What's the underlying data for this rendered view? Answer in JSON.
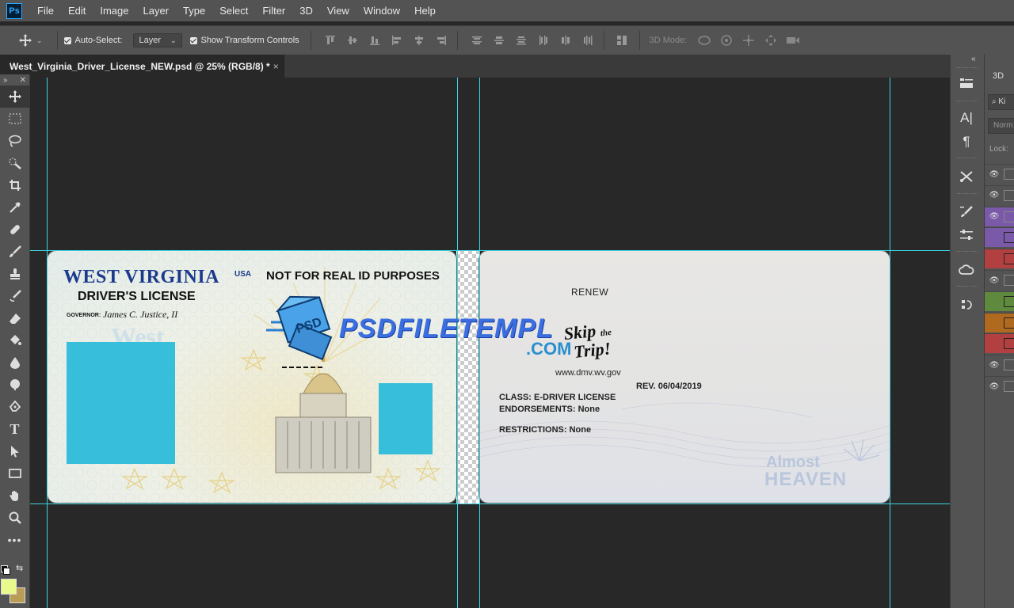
{
  "app": {
    "logo": "Ps"
  },
  "menu": [
    "File",
    "Edit",
    "Image",
    "Layer",
    "Type",
    "Select",
    "Filter",
    "3D",
    "View",
    "Window",
    "Help"
  ],
  "options": {
    "auto_select_label": "Auto-Select:",
    "auto_select_value": "Layer",
    "transform_label": "Show Transform Controls",
    "mode_label": "3D Mode:"
  },
  "document": {
    "tab_title": "West_Virginia_Driver_License_NEW.psd @ 25% (RGB/8) *",
    "close": "×"
  },
  "colors": {
    "foreground": "#e9f98c",
    "background": "#b99c55",
    "guide": "#3ad6e2",
    "photo": "#37bedb"
  },
  "card_front": {
    "state": "WEST VIRGINIA",
    "country": "USA",
    "title": "DRIVER'S LICENSE",
    "governor_label": "GOVERNOR:",
    "governor_name": "James C. Justice, II",
    "real_id": "NOT FOR REAL ID PURPOSES",
    "watermark": "West"
  },
  "watermark": {
    "text": "PSDFILETEMPL",
    "domain": ".COM",
    "badge": "PSD"
  },
  "card_back": {
    "renew": "RENEW",
    "skip1": "Skip",
    "skip2": "the",
    "skip3": "Trip!",
    "url": "www.dmv.wv.gov",
    "rev": "REV. 06/04/2019",
    "class": "CLASS: E-DRIVER LICENSE",
    "endorsements": "ENDORSEMENTS: None",
    "restrictions": "RESTRICTIONS: None",
    "almost": "Almost",
    "heaven": "HEAVEN"
  },
  "layers_panel": {
    "tab": "3D",
    "search": "Ki",
    "mode": "Norm",
    "lock": "Lock:",
    "rows": [
      {
        "eye": true,
        "color": ""
      },
      {
        "eye": true,
        "color": ""
      },
      {
        "eye": true,
        "color": "#7a5aa8"
      },
      {
        "eye": false,
        "color": "#7a5aa8"
      },
      {
        "eye": false,
        "color": "#b34040"
      },
      {
        "eye": true,
        "color": ""
      },
      {
        "eye": false,
        "color": "#5f8a3d"
      },
      {
        "eye": false,
        "color": "#b06a20"
      },
      {
        "eye": false,
        "color": "#b34040"
      },
      {
        "eye": true,
        "color": ""
      },
      {
        "eye": true,
        "color": ""
      }
    ]
  },
  "icons": [
    "move-icon",
    "marquee-icon",
    "lasso-icon",
    "quick-select-icon",
    "crop-icon",
    "eyedropper-icon",
    "healing-icon",
    "brush-icon",
    "stamp-icon",
    "history-brush-icon",
    "eraser-icon",
    "paint-bucket-icon",
    "blur-icon",
    "dodge-icon",
    "pen-icon",
    "type-icon",
    "path-select-icon",
    "rectangle-icon",
    "hand-icon",
    "zoom-icon",
    "more-icon"
  ]
}
